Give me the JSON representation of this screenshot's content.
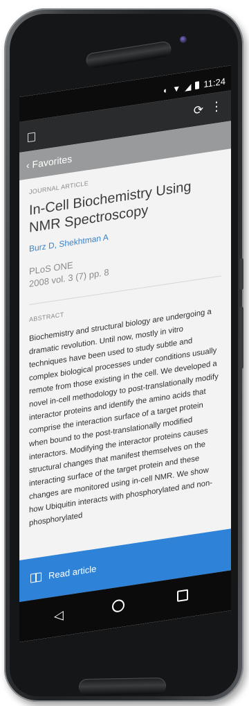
{
  "status_bar": {
    "time": "11:24",
    "icons": [
      "location-icon",
      "wifi-icon",
      "signal-icon",
      "battery-icon"
    ]
  },
  "app_bar": {
    "icons": [
      "app-icon",
      "sync-icon",
      "overflow-menu-icon"
    ]
  },
  "nav": {
    "back_label": "‹ Favorites"
  },
  "article": {
    "type_label": "JOURNAL ARTICLE",
    "title": "In-Cell Biochemistry Using NMR Spectroscopy",
    "authors": "Burz D, Shekhtman A",
    "journal": "PLoS ONE",
    "citation": "2008 vol. 3 (7) pp. 8",
    "abstract_label": "ABSTRACT",
    "abstract": "Biochemistry and structural biology are undergoing a dramatic revolution. Until now, mostly in vitro techniques have been used to study subtle and complex biological processes under conditions usually remote from those existing in the cell. We developed a novel in-cell methodology to post-translationally modify interactor proteins and identify the amino acids that comprise the interaction surface of a target protein when bound to the post-translationally modified interactors. Modifying the interactor proteins causes structural changes that manifest themselves on the interacting surface of the target protein and these changes are monitored using in-cell NMR. We show how Ubiquitin interacts with phosphorylated and non-phosphorylated"
  },
  "read_bar": {
    "label": "Read article",
    "color": "#2e82d8"
  },
  "system_nav": {
    "icons": [
      "back-icon",
      "home-icon",
      "recents-icon"
    ]
  }
}
